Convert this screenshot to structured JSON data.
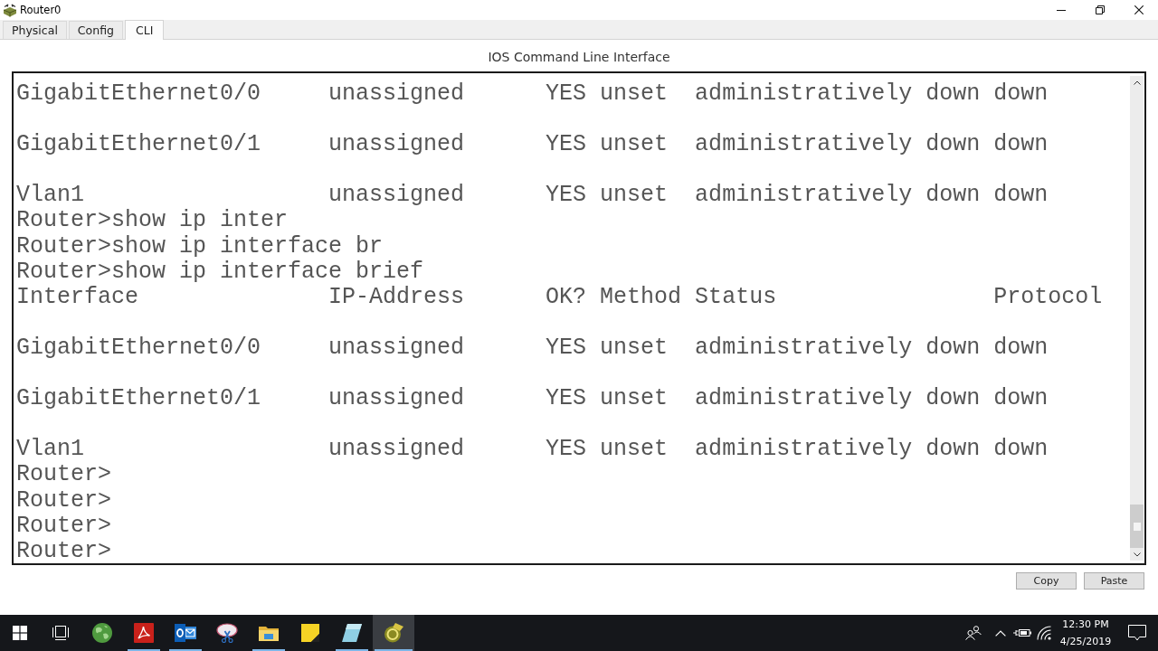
{
  "window": {
    "title": "Router0"
  },
  "tabs": [
    {
      "label": "Physical",
      "selected": false
    },
    {
      "label": "Config",
      "selected": false
    },
    {
      "label": "CLI",
      "selected": true
    }
  ],
  "cli": {
    "title": "IOS Command Line Interface",
    "lines": [
      {
        "text": "GigabitEthernet0/0     unassigned      YES unset  administratively down down",
        "wrapped": true
      },
      {
        "text": "GigabitEthernet0/1     unassigned      YES unset  administratively down down",
        "wrapped": true
      },
      {
        "text": "Vlan1                  unassigned      YES unset  administratively down down",
        "wrapped": false
      },
      {
        "text": "Router>show ip inter",
        "wrapped": false
      },
      {
        "text": "Router>show ip interface br",
        "wrapped": false
      },
      {
        "text": "Router>show ip interface brief",
        "wrapped": false
      },
      {
        "text": "Interface              IP-Address      OK? Method Status                Protocol",
        "wrapped": true
      },
      {
        "text": "GigabitEthernet0/0     unassigned      YES unset  administratively down down",
        "wrapped": true
      },
      {
        "text": "GigabitEthernet0/1     unassigned      YES unset  administratively down down",
        "wrapped": true
      },
      {
        "text": "Vlan1                  unassigned      YES unset  administratively down down",
        "wrapped": false
      },
      {
        "text": "Router>",
        "wrapped": false
      },
      {
        "text": "Router>",
        "wrapped": false
      },
      {
        "text": "Router>",
        "wrapped": false
      },
      {
        "text": "Router>",
        "wrapped": false
      }
    ]
  },
  "buttons": [
    "Copy",
    "Paste"
  ],
  "taskbar": {
    "apps": [
      {
        "running": false,
        "active": false
      },
      {
        "running": true,
        "active": false
      },
      {
        "running": true,
        "active": false
      },
      {
        "running": false,
        "active": false
      },
      {
        "running": true,
        "active": false
      },
      {
        "running": false,
        "active": false
      },
      {
        "running": true,
        "active": false
      },
      {
        "running": true,
        "active": true
      }
    ],
    "clock": {
      "time": "12:30 PM",
      "date": "4/25/2019"
    }
  }
}
